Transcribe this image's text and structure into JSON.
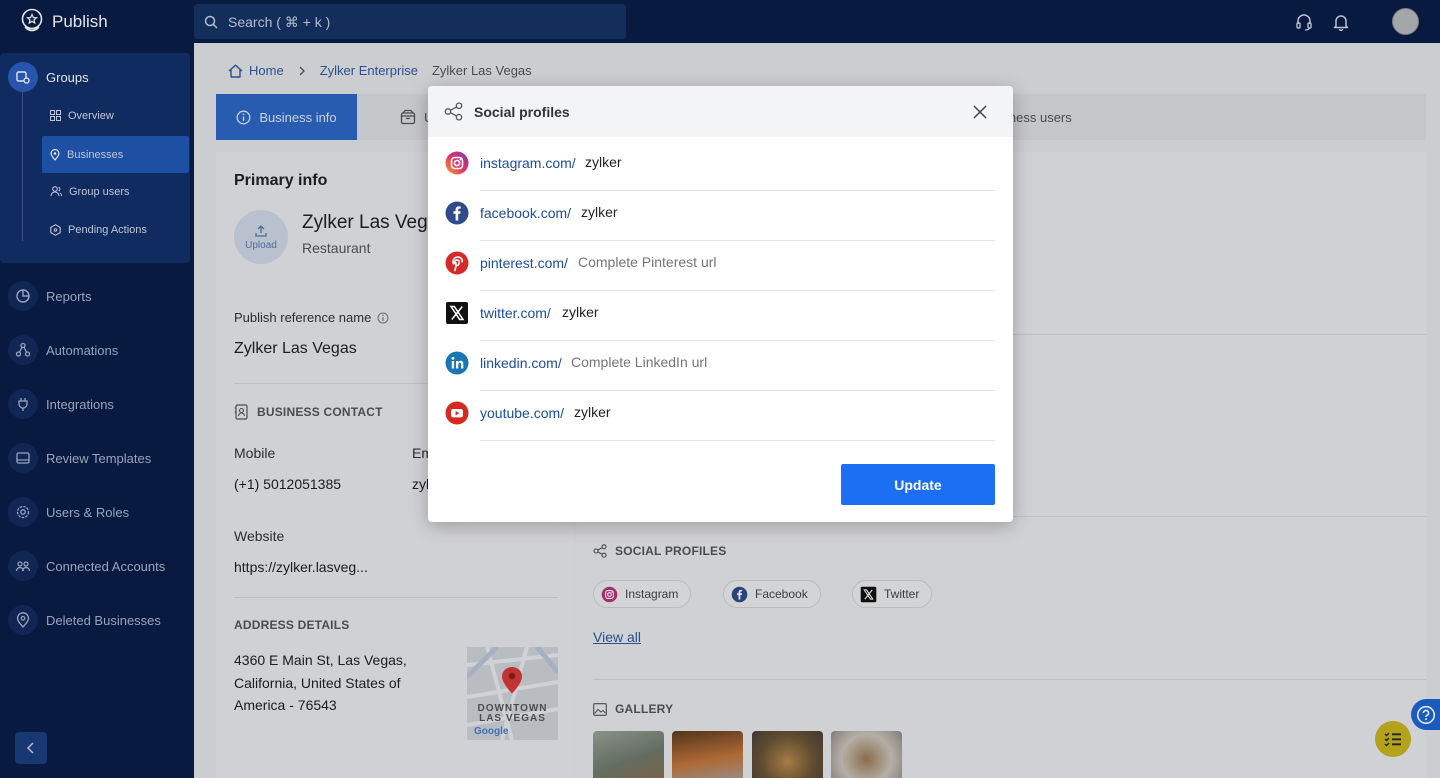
{
  "app": {
    "name": "Publish"
  },
  "search": {
    "placeholder": "Search ( ⌘ + k )"
  },
  "sidebar": {
    "group_label": "Groups",
    "sub_items": [
      {
        "label": "Overview"
      },
      {
        "label": "Businesses"
      },
      {
        "label": "Group users"
      },
      {
        "label": "Pending Actions"
      }
    ],
    "items": [
      {
        "label": "Reports"
      },
      {
        "label": "Automations"
      },
      {
        "label": "Integrations"
      },
      {
        "label": "Review Templates"
      },
      {
        "label": "Users & Roles"
      },
      {
        "label": "Connected Accounts"
      },
      {
        "label": "Deleted Businesses"
      }
    ]
  },
  "breadcrumb": {
    "home": "Home",
    "enterprise": "Zylker Enterprise",
    "current": "Zylker Las Vegas"
  },
  "tabs": {
    "business_info": "Business info",
    "partial_u": "U",
    "business_users_partial": "iness users"
  },
  "primary": {
    "heading": "Primary info",
    "upload": "Upload",
    "business_name": "Zylker Las Vega",
    "category": "Restaurant",
    "ref_label": "Publish reference name",
    "ref_value": "Zylker Las Vegas"
  },
  "contact": {
    "heading": "BUSINESS CONTACT",
    "mobile_label": "Mobile",
    "mobile_value": "(+1) 5012051385",
    "email_label_partial": "Em",
    "email_value_partial": "zyl",
    "website_label": "Website",
    "website_value": "https://zylker.lasveg..."
  },
  "address": {
    "heading": "ADDRESS DETAILS",
    "line1": "4360 E Main St, Las Vegas,",
    "line2": "California, United States of",
    "line3": "America - 76543",
    "map_text_1": "DOWNTOWN",
    "map_text_2": "LAS VEGAS",
    "map_logo": "Google"
  },
  "social_section": {
    "heading": "SOCIAL PROFILES",
    "chips": [
      "Instagram",
      "Facebook",
      "Twitter"
    ],
    "view_all": "View all"
  },
  "gallery": {
    "heading": "GALLERY"
  },
  "modal": {
    "title": "Social profiles",
    "rows": [
      {
        "prefix": "instagram.com/",
        "value": "zylker",
        "placeholder": ""
      },
      {
        "prefix": "facebook.com/",
        "value": "zylker",
        "placeholder": ""
      },
      {
        "prefix": "pinterest.com/",
        "value": "",
        "placeholder": "Complete Pinterest url"
      },
      {
        "prefix": "twitter.com/",
        "value": "zylker",
        "placeholder": ""
      },
      {
        "prefix": "linkedin.com/",
        "value": "",
        "placeholder": "Complete LinkedIn url"
      },
      {
        "prefix": "youtube.com/",
        "value": "zylker",
        "placeholder": ""
      }
    ],
    "update": "Update"
  },
  "colors": {
    "topbar": "#0a1d47",
    "accent": "#1c6ef2",
    "active_tab": "#2d67c4"
  }
}
